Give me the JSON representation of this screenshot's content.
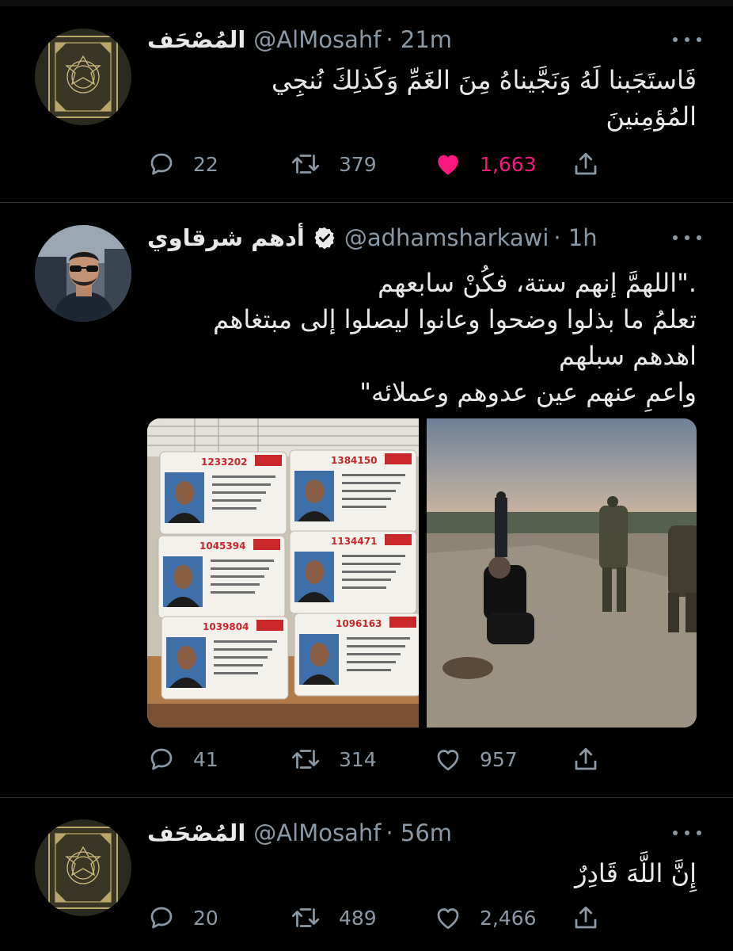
{
  "colors": {
    "background": "#000000",
    "text": "#e7e9ea",
    "muted": "#8b98a5",
    "like": "#f91880",
    "verified": "#e7e9ea"
  },
  "tweets": [
    {
      "name": "المُصْحَف",
      "handle": "@AlMosahf",
      "time": "· 21m",
      "text": "فَاستَجَبنا لَهُ وَنَجَّيناهُ مِنَ الغَمِّ وَكَذلِكَ نُنجِي\nالمُؤمِنينَ",
      "replies": "22",
      "retweets": "379",
      "likes": "1,663",
      "liked": true,
      "avatar_icon": "quran-cover-icon"
    },
    {
      "name": "أدهم شرقاوي",
      "handle": "@adhamsharkawi",
      "time": "· 1h",
      "verified": true,
      "text": ".\"اللهمَّ إنهم ستة، فكُنْ سابعهم\nتعلمُ ما بذلوا وضحوا وعانوا ليصلوا إلى مبتغاهم\nاهدهم سبلهم\nواعمِ عنهم عين عدوهم وعملائه\"",
      "replies": "41",
      "retweets": "314",
      "likes": "957",
      "liked": false,
      "avatar_icon": "user-photo-avatar",
      "media": {
        "left_image": "prisoner-id-cards-image",
        "right_image": "soldiers-tunnel-image",
        "cards": [
          {
            "number": "1233202"
          },
          {
            "number": "1384150"
          },
          {
            "number": "1045394"
          },
          {
            "number": "1134471"
          },
          {
            "number": "1039804"
          },
          {
            "number": "1096163"
          }
        ]
      }
    },
    {
      "name": "المُصْحَف",
      "handle": "@AlMosahf",
      "time": "· 56m",
      "text": "إِنَّ اللَّهَ قَادِرٌ",
      "replies": "20",
      "retweets": "489",
      "likes": "2,466",
      "liked": false,
      "avatar_icon": "quran-cover-icon"
    }
  ]
}
